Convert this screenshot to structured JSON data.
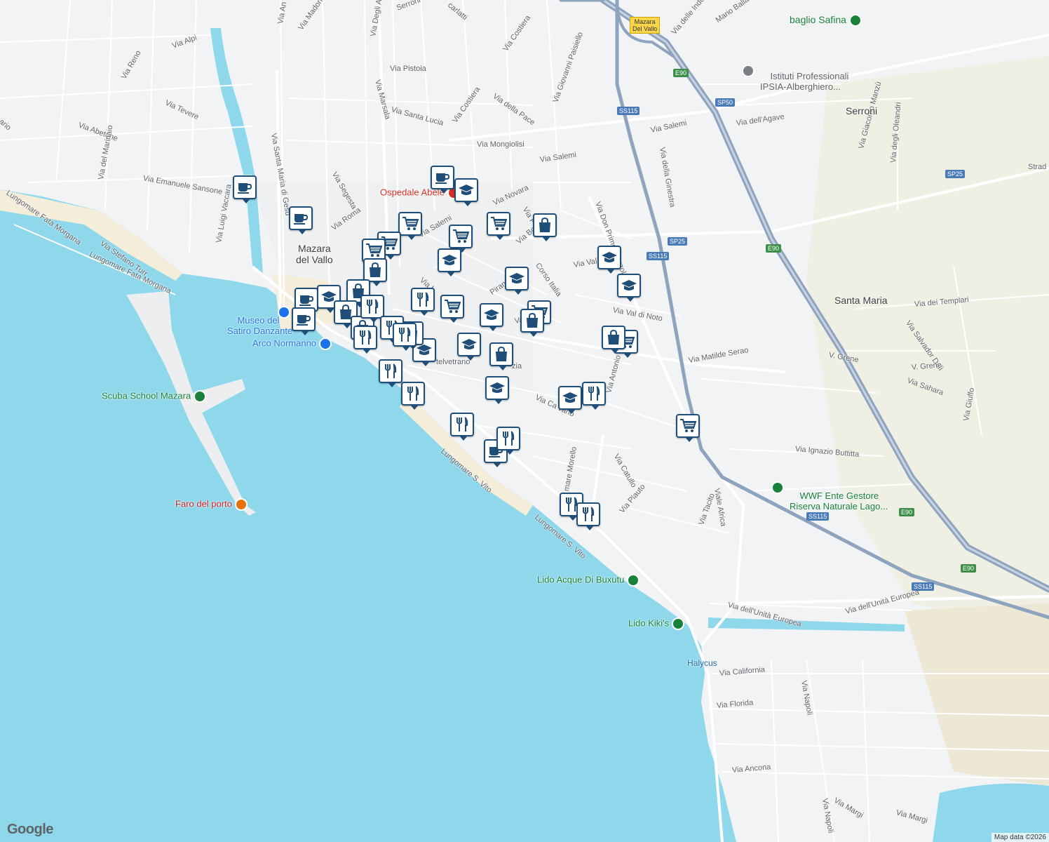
{
  "map": {
    "colors": {
      "sea": "#8fd8ec",
      "land": "#f2f3f5",
      "road": "#ffffff",
      "highway": "#8ea3be",
      "sand": "#f3edd9",
      "park": "#eceedd",
      "marker_border": "#1f4e79"
    },
    "street_labels": [
      {
        "id": "via-salemi-1",
        "text": "Via Salemi"
      },
      {
        "id": "via-salemi-2",
        "text": "Via Salemi"
      },
      {
        "id": "via-salemi-3",
        "text": "Via Salemi"
      },
      {
        "id": "via-mongiolisi",
        "text": "Via Mongiolisi"
      },
      {
        "id": "via-costiera-1",
        "text": "Via Costiera"
      },
      {
        "id": "via-costiera-2",
        "text": "Via Costiera"
      },
      {
        "id": "via-della-pace",
        "text": "Via della Pace"
      },
      {
        "id": "via-giovanni-paisiello",
        "text": "Via Giovanni Paisiello"
      },
      {
        "id": "via-pistoia",
        "text": "Via Pistoia"
      },
      {
        "id": "via-santa-lucia",
        "text": "Via Santa Lucia"
      },
      {
        "id": "via-marsala",
        "text": "Via Marsala"
      },
      {
        "id": "via-degli-archi",
        "text": "Via Degli Archi"
      },
      {
        "id": "via-madonie",
        "text": "Via Madonie"
      },
      {
        "id": "via-alpi",
        "text": "Via Alpi"
      },
      {
        "id": "via-reno",
        "text": "Via Reno"
      },
      {
        "id": "via-tevere",
        "text": "Via Tevere"
      },
      {
        "id": "via-abetone",
        "text": "Via Abetone"
      },
      {
        "id": "via-del-marinaio",
        "text": "Via del Marinaio"
      },
      {
        "id": "via-emanuele-sansone",
        "text": "Via Emanuele Sansone"
      },
      {
        "id": "lungomare-fata-morgana-1",
        "text": "Lungomare Fata Morgana"
      },
      {
        "id": "lungomare-fata-morgana-2",
        "text": "Lungomare Fata Morgana"
      },
      {
        "id": "via-stefano-turr",
        "text": "Via Stefano Turr"
      },
      {
        "id": "via-luigi-vaccara",
        "text": "Via Luigi Vaccara"
      },
      {
        "id": "via-santa-maria-di-gesu",
        "text": "Via Santa Maria di Gesù"
      },
      {
        "id": "via-segesta",
        "text": "Via Segesta"
      },
      {
        "id": "via-roma",
        "text": "Via Roma"
      },
      {
        "id": "via-novara",
        "text": "Via Novara"
      },
      {
        "id": "via-bolz",
        "text": "Via Bolz"
      },
      {
        "id": "corso-italia",
        "text": "Corso Italia"
      },
      {
        "id": "via-don-primo-mazzolari",
        "text": "Via Don Primo Mazzolari"
      },
      {
        "id": "via-della-ginestra",
        "text": "Via della Ginestra"
      },
      {
        "id": "via-val-di-noto",
        "text": "Via Val di Noto"
      },
      {
        "id": "via-val",
        "text": "Via Val"
      },
      {
        "id": "via-matilde-serao",
        "text": "Via Matilde Serao"
      },
      {
        "id": "via-antonio-segni",
        "text": "Via Antonio Segni"
      },
      {
        "id": "via-catullo",
        "text": "Via Catullo"
      },
      {
        "id": "via-plauto",
        "text": "Via Plauto"
      },
      {
        "id": "via-tacito",
        "text": "Via Tacito"
      },
      {
        "id": "viale-africa",
        "text": "Viale Africa"
      },
      {
        "id": "via-ignazio-buttitta",
        "text": "Via Ignazio Buttitta"
      },
      {
        "id": "via-dell-unita-europea-1",
        "text": "Via dell'Unità Europea"
      },
      {
        "id": "via-dell-unita-europea-2",
        "text": "Via dell'Unità Europea"
      },
      {
        "id": "via-california",
        "text": "Via California"
      },
      {
        "id": "via-florida",
        "text": "Via Florida"
      },
      {
        "id": "via-ancona",
        "text": "Via Ancona"
      },
      {
        "id": "via-napoli-1",
        "text": "Via Napoli"
      },
      {
        "id": "via-napoli-2",
        "text": "Via Napoli"
      },
      {
        "id": "via-margi-1",
        "text": "Via Margi"
      },
      {
        "id": "via-margi-2",
        "text": "Via Margi"
      },
      {
        "id": "lungomare-s-vito-1",
        "text": "Lungomare S. Vito"
      },
      {
        "id": "lungomare-s-vito-2",
        "text": "Lungomare S. Vito"
      },
      {
        "id": "via-dell-agave",
        "text": "Via dell'Agave"
      },
      {
        "id": "via-giacomo-manzu",
        "text": "Via Giacomo Manzù"
      },
      {
        "id": "via-degli-oleandri",
        "text": "Via degli Oleandri"
      },
      {
        "id": "via-dei-templari",
        "text": "Via dei Templari"
      },
      {
        "id": "via-salvador-dali",
        "text": "Via Salvador Dalì"
      },
      {
        "id": "v-grene-1",
        "text": "V. Grene"
      },
      {
        "id": "v-grene-2",
        "text": "V. Grene"
      },
      {
        "id": "via-sahara",
        "text": "Via Sahara"
      },
      {
        "id": "via-giuffo",
        "text": "Via Giuffo"
      },
      {
        "id": "via-delle-industrie",
        "text": "Via delle Industrie"
      },
      {
        "id": "mario-ballatore",
        "text": "Mario Ballatore"
      },
      {
        "id": "strad",
        "text": "Strad"
      },
      {
        "id": "telvetrano",
        "text": "telvetrano"
      },
      {
        "id": "zia",
        "text": "zia"
      },
      {
        "id": "via-ca-vano",
        "text": "Via Ca      vano"
      },
      {
        "id": "mare-morello",
        "text": "mare Morello"
      },
      {
        "id": "via-p",
        "text": "Via P"
      },
      {
        "id": "val-di",
        "text": "Val di"
      },
      {
        "id": "piran",
        "text": "Piran"
      },
      {
        "id": "via-l",
        "text": "Via L"
      },
      {
        "id": "serroni-st",
        "text": "Serroni"
      },
      {
        "id": "scarlatti",
        "text": "carlatti"
      },
      {
        "id": "via-an",
        "text": "Via An"
      },
      {
        "id": "ario",
        "text": "ario"
      }
    ],
    "places": [
      {
        "id": "mazara-del-vallo",
        "text": "Mazara\ndel Vallo"
      },
      {
        "id": "serroni",
        "text": "Serroni"
      },
      {
        "id": "santa-maria",
        "text": "Santa Maria"
      },
      {
        "id": "halycus",
        "text": "Halycus"
      }
    ],
    "pois": [
      {
        "id": "ospedale",
        "text": "Ospedale Abele",
        "color": "#d93025",
        "icon": "hospital-icon"
      },
      {
        "id": "museo",
        "text": "Museo del\nSatiro Danzante",
        "color": "#1a73e8",
        "icon": "museum-icon"
      },
      {
        "id": "arco",
        "text": "Arco Normanno",
        "color": "#1a73e8",
        "icon": "camera-icon"
      },
      {
        "id": "scuba",
        "text": "Scuba School Mazara",
        "color": "#188038",
        "icon": "leisure-icon"
      },
      {
        "id": "faro",
        "text": "Faro del porto",
        "color": "#c5221f",
        "icon": "camera-icon"
      },
      {
        "id": "lido-buxutu",
        "text": "Lido Acque Di Buxutu",
        "color": "#188038",
        "icon": "leisure-icon"
      },
      {
        "id": "lido-kikis",
        "text": "Lido Kiki's",
        "color": "#188038",
        "icon": "leisure-icon"
      },
      {
        "id": "wwf",
        "text": "WWF Ente Gestore\nRiserva Naturale Lago...",
        "color": "#188038",
        "icon": "tree-icon"
      },
      {
        "id": "baglio",
        "text": "baglio Safina",
        "color": "#188038",
        "icon": "flower-icon"
      },
      {
        "id": "istituti",
        "text": "Istituti Professionali\nIPSIA-Alberghiero...",
        "color": "#5f6368",
        "icon": "school-icon"
      }
    ],
    "road_shields": [
      {
        "id": "ss115-1",
        "text": "SS115",
        "type": "ss"
      },
      {
        "id": "ss115-2",
        "text": "SS115",
        "type": "ss"
      },
      {
        "id": "ss115-3",
        "text": "SS115",
        "type": "ss"
      },
      {
        "id": "ss115-4",
        "text": "SS115",
        "type": "ss"
      },
      {
        "id": "sp50",
        "text": "SP50",
        "type": "ss"
      },
      {
        "id": "sp25-1",
        "text": "SP25",
        "type": "ss"
      },
      {
        "id": "sp25-2",
        "text": "SP25",
        "type": "ss"
      },
      {
        "id": "e90-1",
        "text": "E90",
        "type": "e"
      },
      {
        "id": "e90-2",
        "text": "E90",
        "type": "e"
      },
      {
        "id": "e90-3",
        "text": "E90",
        "type": "e"
      },
      {
        "id": "e90-4",
        "text": "E90",
        "type": "e"
      },
      {
        "id": "exit",
        "text": "Mazara\nDel Vallo",
        "type": "exit"
      }
    ],
    "markers": [
      {
        "type": "coffee"
      },
      {
        "type": "coffee"
      },
      {
        "type": "coffee"
      },
      {
        "type": "coffee"
      },
      {
        "type": "coffee"
      },
      {
        "type": "coffee"
      },
      {
        "type": "school"
      },
      {
        "type": "school"
      },
      {
        "type": "school"
      },
      {
        "type": "school"
      },
      {
        "type": "school"
      },
      {
        "type": "school"
      },
      {
        "type": "school"
      },
      {
        "type": "school"
      },
      {
        "type": "school"
      },
      {
        "type": "school"
      },
      {
        "type": "school"
      },
      {
        "type": "cart"
      },
      {
        "type": "cart"
      },
      {
        "type": "cart"
      },
      {
        "type": "cart"
      },
      {
        "type": "cart"
      },
      {
        "type": "cart"
      },
      {
        "type": "cart"
      },
      {
        "type": "cart"
      },
      {
        "type": "cart"
      },
      {
        "type": "bag"
      },
      {
        "type": "bag"
      },
      {
        "type": "bag"
      },
      {
        "type": "bag"
      },
      {
        "type": "bag"
      },
      {
        "type": "bag"
      },
      {
        "type": "bag"
      },
      {
        "type": "bag"
      },
      {
        "type": "bag"
      },
      {
        "type": "food"
      },
      {
        "type": "food"
      },
      {
        "type": "food"
      },
      {
        "type": "food"
      },
      {
        "type": "food"
      },
      {
        "type": "food"
      },
      {
        "type": "food"
      },
      {
        "type": "food"
      },
      {
        "type": "food"
      },
      {
        "type": "food"
      },
      {
        "type": "food"
      },
      {
        "type": "food"
      }
    ],
    "attribution": {
      "logo": "Google",
      "credit": "Map data ©2026"
    }
  }
}
